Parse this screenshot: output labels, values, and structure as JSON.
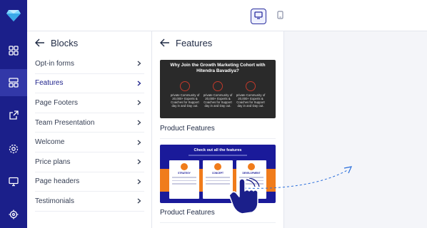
{
  "rail": {
    "items": [
      {
        "icon": "grid-icon"
      },
      {
        "icon": "layout-icon"
      },
      {
        "icon": "external-link-icon"
      },
      {
        "icon": "settings-icon"
      },
      {
        "icon": "monitor-icon"
      },
      {
        "icon": "target-icon"
      }
    ],
    "active_index": 1
  },
  "topbar": {
    "devices": [
      "desktop-view",
      "mobile-view"
    ],
    "active_device": "desktop-view"
  },
  "blocks": {
    "title": "Blocks",
    "items": [
      {
        "label": "Opt-in forms"
      },
      {
        "label": "Features"
      },
      {
        "label": "Page Footers"
      },
      {
        "label": "Team Presentation"
      },
      {
        "label": "Welcome"
      },
      {
        "label": "Price plans"
      },
      {
        "label": "Page headers"
      },
      {
        "label": "Testimonials"
      }
    ],
    "active_index": 1
  },
  "features": {
    "title": "Features",
    "cards": [
      {
        "heading": "Why Join the Growth Marketing Cohort with Hitendra Bavadiya?",
        "columns": [
          "private Community of 20,000+ Experts & Coaches for Support day in and Day out.",
          "private Community of 20,000+ Experts & Coaches for Support day in and Day out.",
          "private Community of 20,000+ Experts & Coaches for Support day in and Day out."
        ],
        "label": "Product Features"
      },
      {
        "heading": "Check out all the features",
        "columns": [
          "STRATEGY",
          "CONCEPT",
          "DEVELOPMENT"
        ],
        "label": "Product Features"
      }
    ]
  },
  "colors": {
    "rail_bg": "#1b1f8a",
    "accent": "#2b2f9e",
    "orange": "#f07c1b"
  }
}
